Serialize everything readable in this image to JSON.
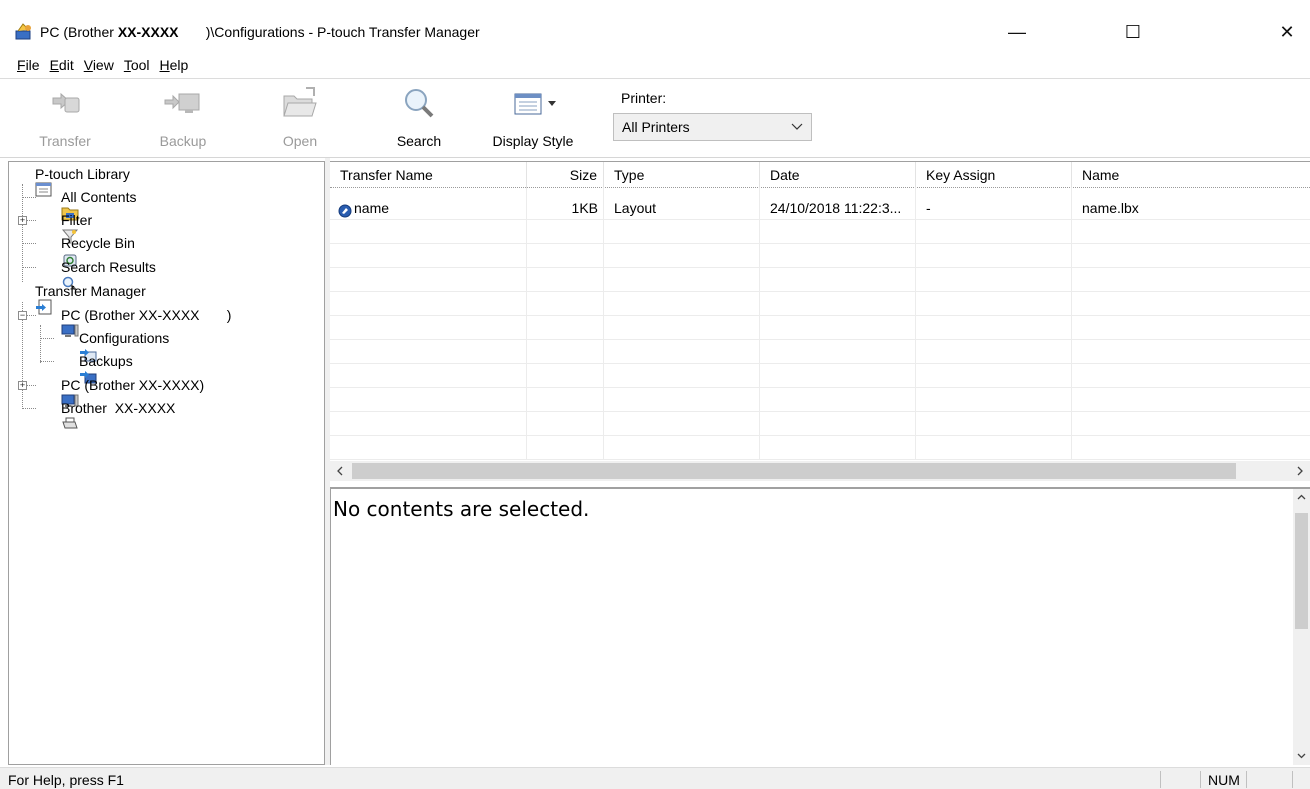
{
  "window": {
    "title_prefix": "PC (Brother ",
    "title_bold": "XX-XXXX",
    "title_suffix": "       )\\Configurations - P-touch Transfer Manager",
    "minimize_glyph": "—",
    "maximize_glyph": "☐",
    "close_glyph": "✕"
  },
  "menu": [
    {
      "hotkey": "F",
      "rest": "ile"
    },
    {
      "hotkey": "E",
      "rest": "dit"
    },
    {
      "hotkey": "V",
      "rest": "iew"
    },
    {
      "hotkey": "T",
      "rest": "ool"
    },
    {
      "hotkey": "H",
      "rest": "elp"
    }
  ],
  "toolbar": {
    "transfer_label": "Transfer",
    "backup_label": "Backup",
    "open_label": "Open",
    "search_label": "Search",
    "display_style_label": "Display Style",
    "printer_label": "Printer:",
    "printer_value": "All Printers"
  },
  "tree": {
    "library": "P-touch Library",
    "all_contents": "All Contents",
    "filter": "Filter",
    "recycle_bin": "Recycle Bin",
    "search_results": "Search Results",
    "transfer_manager": "Transfer Manager",
    "pc1": "PC (Brother XX-XXXX       )",
    "configurations": "Configurations",
    "backups": "Backups",
    "pc2": "PC (Brother XX-XXXX)",
    "brother": "Brother  XX-XXXX"
  },
  "table": {
    "headers": [
      "Transfer Name",
      "Size",
      "Type",
      "Date",
      "Key Assign",
      "Name"
    ],
    "rows": [
      [
        "name",
        "1KB",
        "Layout",
        "24/10/2018 11:22:3...",
        "-",
        "name.lbx"
      ]
    ]
  },
  "detail": {
    "message": "No contents are selected."
  },
  "status": {
    "help": "For Help, press F1",
    "num": "NUM"
  }
}
